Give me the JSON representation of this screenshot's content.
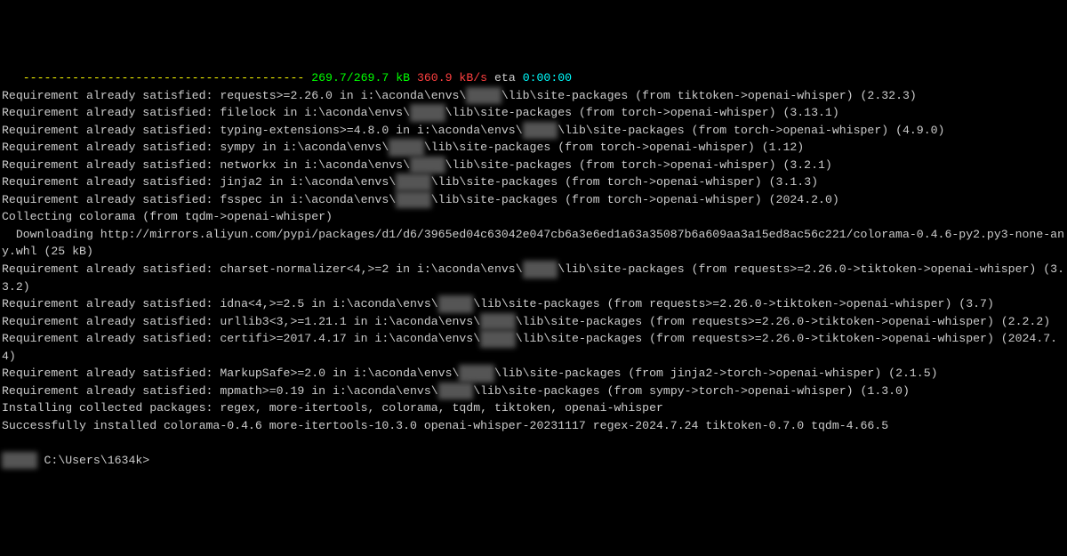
{
  "progress": {
    "dashes": "   ----------------------------------------",
    "done_fraction": "269.7/269.7 kB",
    "speed": "360.9 kB/s",
    "eta_label": "eta",
    "eta_time": "0:00:00"
  },
  "env_path_prefix": "i:\\aconda\\envs\\",
  "env_name_blur": "xxxxx",
  "site_pkgs_suffix": "\\lib\\site-packages",
  "lines": [
    {
      "pkg": "requests>=2.26.0",
      "chain": "(from tiktoken->openai-whisper)",
      "ver": "(2.32.3)"
    },
    {
      "pkg": "filelock",
      "chain": "(from torch->openai-whisper)",
      "ver": "(3.13.1)"
    },
    {
      "pkg": "typing-extensions>=4.8.0",
      "chain": "(from torch->openai-whisper)",
      "ver": "(4.9.0)"
    },
    {
      "pkg": "sympy",
      "chain": "(from torch->openai-whisper)",
      "ver": "(1.12)"
    },
    {
      "pkg": "networkx",
      "chain": "(from torch->openai-whisper)",
      "ver": "(3.2.1)"
    },
    {
      "pkg": "jinja2",
      "chain": "(from torch->openai-whisper)",
      "ver": "(3.1.3)"
    },
    {
      "pkg": "fsspec",
      "chain": "(from torch->openai-whisper)",
      "ver": "(2024.2.0)"
    }
  ],
  "collecting": "Collecting colorama (from tqdm->openai-whisper)",
  "downloading": "  Downloading http://mirrors.aliyun.com/pypi/packages/d1/d6/3965ed04c63042e047cb6a3e6ed1a63a35087b6a609aa3a15ed8ac56c221/colorama-0.4.6-py2.py3-none-any.whl (25 kB)",
  "lines2": [
    {
      "pkg": "charset-normalizer<4,>=2",
      "chain": "(from requests>=2.26.0->tiktoken->openai-whisper)",
      "ver": "(3.3.2)"
    },
    {
      "pkg": "idna<4,>=2.5",
      "chain": "(from requests>=2.26.0->tiktoken->openai-whisper)",
      "ver": "(3.7)"
    },
    {
      "pkg": "urllib3<3,>=1.21.1",
      "chain": "(from requests>=2.26.0->tiktoken->openai-whisper)",
      "ver": "(2.2.2)"
    },
    {
      "pkg": "certifi>=2017.4.17",
      "chain": "(from requests>=2.26.0->tiktoken->openai-whisper)",
      "ver": "(2024.7.4)"
    },
    {
      "pkg": "MarkupSafe>=2.0",
      "chain": "(from jinja2->torch->openai-whisper)",
      "ver": "(2.1.5)"
    },
    {
      "pkg": "mpmath>=0.19",
      "chain": "(from sympy->torch->openai-whisper)",
      "ver": "(1.3.0)"
    }
  ],
  "installing": "Installing collected packages: regex, more-itertools, colorama, tqdm, tiktoken, openai-whisper",
  "success": "Successfully installed colorama-0.4.6 more-itertools-10.3.0 openai-whisper-20231117 regex-2024.7.24 tiktoken-0.7.0 tqdm-4.66.5",
  "prompt_blur": "xxxxx",
  "prompt_path": " C:\\Users\\1634k>",
  "req_prefix": "Requirement already satisfied: ",
  "in_word": " in "
}
